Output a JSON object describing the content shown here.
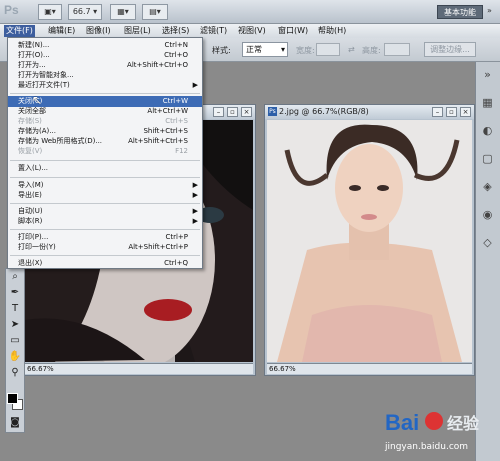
{
  "app": {
    "logo": "Ps",
    "zoom": "66.7",
    "workspace": "基本功能"
  },
  "menubar": [
    {
      "label": "文件(F)",
      "active": true
    },
    {
      "label": "编辑(E)"
    },
    {
      "label": "图像(I)"
    },
    {
      "label": "图层(L)"
    },
    {
      "label": "选择(S)"
    },
    {
      "label": "滤镜(T)"
    },
    {
      "label": "视图(V)"
    },
    {
      "label": "窗口(W)"
    },
    {
      "label": "帮助(H)"
    }
  ],
  "options": {
    "style_label": "样式:",
    "style_value": "正常",
    "width_label": "宽度:",
    "height_label": "高度:",
    "refine_edge": "调整边缘..."
  },
  "file_menu": [
    {
      "label": "新建(N)...",
      "shortcut": "Ctrl+N"
    },
    {
      "label": "打开(O)...",
      "shortcut": "Ctrl+O"
    },
    {
      "label": "打开为...",
      "shortcut": "Alt+Shift+Ctrl+O"
    },
    {
      "label": "打开为智能对象..."
    },
    {
      "label": "最近打开文件(T)",
      "submenu": true
    },
    {
      "separator": true
    },
    {
      "label": "关闭(C)",
      "shortcut": "Ctrl+W",
      "highlighted": true
    },
    {
      "label": "关闭全部",
      "shortcut": "Alt+Ctrl+W"
    },
    {
      "label": "存储(S)",
      "shortcut": "Ctrl+S",
      "disabled": true
    },
    {
      "label": "存储为(A)...",
      "shortcut": "Shift+Ctrl+S"
    },
    {
      "label": "存储为 Web所用格式(D)...",
      "shortcut": "Alt+Shift+Ctrl+S"
    },
    {
      "label": "恢复(V)",
      "shortcut": "F12",
      "disabled": true
    },
    {
      "separator": true
    },
    {
      "label": "置入(L)..."
    },
    {
      "separator": true
    },
    {
      "label": "导入(M)",
      "submenu": true
    },
    {
      "label": "导出(E)",
      "submenu": true
    },
    {
      "separator": true
    },
    {
      "label": "自动(U)",
      "submenu": true
    },
    {
      "label": "脚本(R)",
      "submenu": true
    },
    {
      "separator": true
    },
    {
      "label": "打印(P)...",
      "shortcut": "Ctrl+P"
    },
    {
      "label": "打印一份(Y)",
      "shortcut": "Alt+Shift+Ctrl+P"
    },
    {
      "separator": true
    },
    {
      "label": "退出(X)",
      "shortcut": "Ctrl+Q"
    }
  ],
  "doc_left": {
    "zoom": "66.67%"
  },
  "doc_right": {
    "title": "2.jpg @ 66.7%(RGB/8)",
    "zoom": "66.67%"
  },
  "watermark": {
    "brand": "Bai",
    "brand2": "经验",
    "url": "jingyan.baidu.com"
  }
}
